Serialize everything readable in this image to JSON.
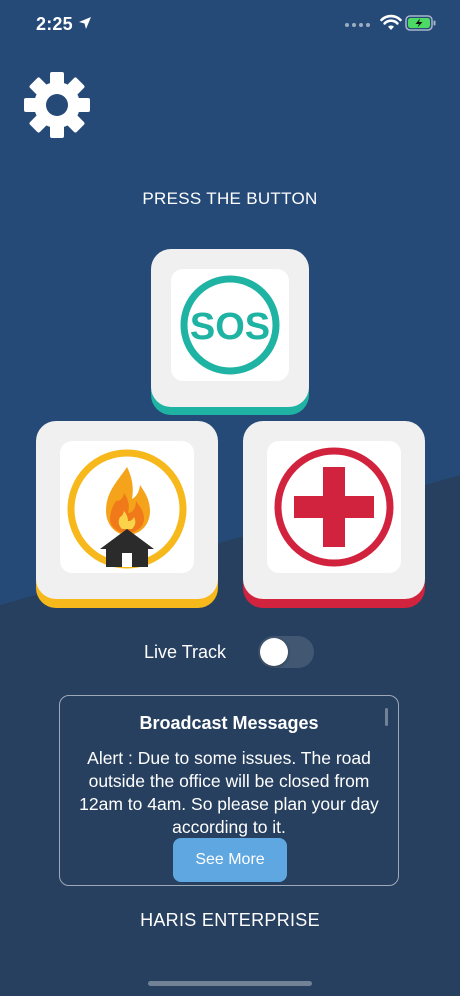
{
  "status_bar": {
    "time": "2:25"
  },
  "main": {
    "instruction": "PRESS THE BUTTON",
    "sos_text": "SOS",
    "live_track_label": "Live Track",
    "live_track_on": false
  },
  "broadcast": {
    "title": "Broadcast Messages",
    "message": "Alert : Due to some issues. The road outside the office will be closed from 12am to 4am. So please plan your day according to it.",
    "see_more_label": "See More"
  },
  "footer": {
    "company": "HARIS ENTERPRISE"
  },
  "colors": {
    "background_top": "#254a78",
    "background_bottom": "#27405f",
    "sos_accent": "#1eb3a2",
    "fire_accent": "#f6b81a",
    "medical_accent": "#d2233e",
    "button_blue": "#5fa7e0"
  },
  "icons": {
    "settings": "gear-icon",
    "sos": "sos-icon",
    "fire": "house-fire-icon",
    "medical": "medical-cross-icon"
  }
}
